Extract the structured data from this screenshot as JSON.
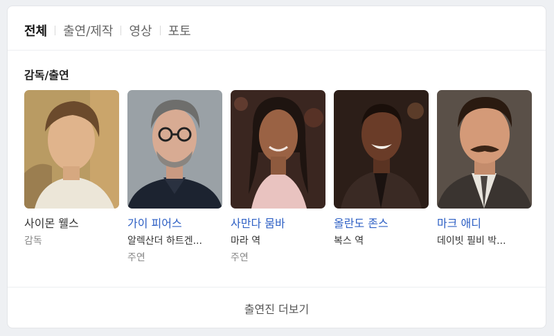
{
  "tabs": [
    {
      "label": "전체",
      "active": true
    },
    {
      "label": "출연/제작",
      "active": false
    },
    {
      "label": "영상",
      "active": false
    },
    {
      "label": "포토",
      "active": false
    }
  ],
  "section_title": "감독/출연",
  "people": [
    {
      "name": "사이몬 웰스",
      "role": "감독",
      "sub": "",
      "photo_icon": "person-photo"
    },
    {
      "name": "가이 피어스",
      "role": "알렉산더 하트겐...",
      "sub": "주연",
      "photo_icon": "person-photo"
    },
    {
      "name": "사만다 뭄바",
      "role": "마라 역",
      "sub": "주연",
      "photo_icon": "person-photo"
    },
    {
      "name": "올란도 존스",
      "role": "복스 역",
      "sub": "",
      "photo_icon": "person-photo"
    },
    {
      "name": "마크 애디",
      "role": "데이빗 필비 박...",
      "sub": "",
      "photo_icon": "person-photo"
    }
  ],
  "more_label": "출연진 더보기",
  "colors": {
    "link": "#2d5fc4",
    "text": "#333333",
    "muted": "#888888"
  }
}
